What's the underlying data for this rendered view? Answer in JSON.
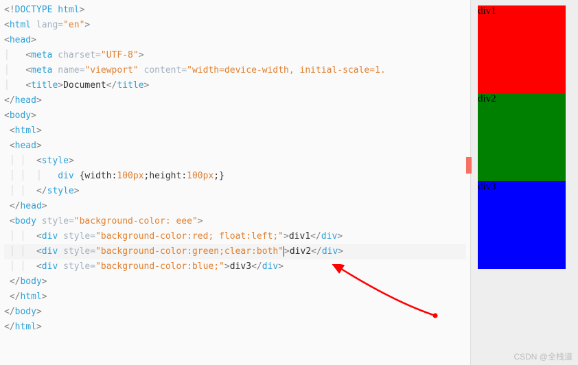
{
  "editor": {
    "lines": [
      {
        "indent": 0,
        "segments": [
          {
            "cls": "tag-bracket",
            "t": "<!"
          },
          {
            "cls": "doctype-kw",
            "t": "DOCTYPE"
          },
          {
            "cls": "plain",
            "t": " "
          },
          {
            "cls": "doctype-kw",
            "t": "html"
          },
          {
            "cls": "tag-bracket",
            "t": ">"
          }
        ]
      },
      {
        "indent": 0,
        "segments": [
          {
            "cls": "tag-bracket",
            "t": "<"
          },
          {
            "cls": "tag-name",
            "t": "html"
          },
          {
            "cls": "plain",
            "t": " "
          },
          {
            "cls": "attr-name",
            "t": "lang"
          },
          {
            "cls": "attr-eq",
            "t": "="
          },
          {
            "cls": "attr-val",
            "t": "\"en\""
          },
          {
            "cls": "tag-bracket",
            "t": ">"
          }
        ]
      },
      {
        "indent": 0,
        "segments": [
          {
            "cls": "tag-bracket",
            "t": "<"
          },
          {
            "cls": "tag-name",
            "t": "head"
          },
          {
            "cls": "tag-bracket",
            "t": ">"
          }
        ]
      },
      {
        "indent": 2,
        "guide": true,
        "segments": [
          {
            "cls": "tag-bracket",
            "t": "<"
          },
          {
            "cls": "tag-name",
            "t": "meta"
          },
          {
            "cls": "plain",
            "t": " "
          },
          {
            "cls": "attr-name",
            "t": "charset"
          },
          {
            "cls": "attr-eq",
            "t": "="
          },
          {
            "cls": "attr-val",
            "t": "\"UTF-8\""
          },
          {
            "cls": "tag-bracket",
            "t": ">"
          }
        ]
      },
      {
        "indent": 2,
        "guide": true,
        "segments": [
          {
            "cls": "tag-bracket",
            "t": "<"
          },
          {
            "cls": "tag-name",
            "t": "meta"
          },
          {
            "cls": "plain",
            "t": " "
          },
          {
            "cls": "attr-name",
            "t": "name"
          },
          {
            "cls": "attr-eq",
            "t": "="
          },
          {
            "cls": "attr-val",
            "t": "\"viewport\""
          },
          {
            "cls": "plain",
            "t": " "
          },
          {
            "cls": "attr-name",
            "t": "content"
          },
          {
            "cls": "attr-eq",
            "t": "="
          },
          {
            "cls": "attr-val",
            "t": "\"width=device-width, initial-scale=1."
          }
        ]
      },
      {
        "indent": 2,
        "guide": true,
        "segments": [
          {
            "cls": "tag-bracket",
            "t": "<"
          },
          {
            "cls": "tag-name",
            "t": "title"
          },
          {
            "cls": "tag-bracket",
            "t": ">"
          },
          {
            "cls": "plain",
            "t": "Document"
          },
          {
            "cls": "tag-bracket",
            "t": "</"
          },
          {
            "cls": "tag-name",
            "t": "title"
          },
          {
            "cls": "tag-bracket",
            "t": ">"
          }
        ]
      },
      {
        "indent": 0,
        "segments": [
          {
            "cls": "tag-bracket",
            "t": "</"
          },
          {
            "cls": "tag-name",
            "t": "head"
          },
          {
            "cls": "tag-bracket",
            "t": ">"
          }
        ]
      },
      {
        "indent": 0,
        "segments": [
          {
            "cls": "tag-bracket",
            "t": "<"
          },
          {
            "cls": "tag-name",
            "t": "body"
          },
          {
            "cls": "tag-bracket",
            "t": ">"
          }
        ]
      },
      {
        "indent": 1,
        "segments": [
          {
            "cls": "tag-bracket",
            "t": "<"
          },
          {
            "cls": "tag-name",
            "t": "html"
          },
          {
            "cls": "tag-bracket",
            "t": ">"
          }
        ]
      },
      {
        "indent": 1,
        "segments": [
          {
            "cls": "tag-bracket",
            "t": "<"
          },
          {
            "cls": "tag-name",
            "t": "head"
          },
          {
            "cls": "tag-bracket",
            "t": ">"
          }
        ]
      },
      {
        "indent": 3,
        "guide": true,
        "segments": [
          {
            "cls": "tag-bracket",
            "t": "<"
          },
          {
            "cls": "tag-name",
            "t": "style"
          },
          {
            "cls": "tag-bracket",
            "t": ">"
          }
        ]
      },
      {
        "indent": 4,
        "guide": true,
        "segments": [
          {
            "cls": "css-sel",
            "t": "div"
          },
          {
            "cls": "plain",
            "t": " {"
          },
          {
            "cls": "css-prop",
            "t": "width"
          },
          {
            "cls": "plain",
            "t": ":"
          },
          {
            "cls": "css-val",
            "t": "100px"
          },
          {
            "cls": "plain",
            "t": ";"
          },
          {
            "cls": "css-prop",
            "t": "height"
          },
          {
            "cls": "plain",
            "t": ":"
          },
          {
            "cls": "css-val",
            "t": "100px"
          },
          {
            "cls": "plain",
            "t": ";}"
          }
        ]
      },
      {
        "indent": 3,
        "guide": true,
        "segments": [
          {
            "cls": "tag-bracket",
            "t": "</"
          },
          {
            "cls": "tag-name",
            "t": "style"
          },
          {
            "cls": "tag-bracket",
            "t": ">"
          }
        ]
      },
      {
        "indent": 1,
        "segments": [
          {
            "cls": "tag-bracket",
            "t": "</"
          },
          {
            "cls": "tag-name",
            "t": "head"
          },
          {
            "cls": "tag-bracket",
            "t": ">"
          }
        ]
      },
      {
        "indent": 1,
        "segments": [
          {
            "cls": "tag-bracket",
            "t": "<"
          },
          {
            "cls": "tag-name",
            "t": "body"
          },
          {
            "cls": "plain",
            "t": " "
          },
          {
            "cls": "attr-name",
            "t": "style"
          },
          {
            "cls": "attr-eq",
            "t": "="
          },
          {
            "cls": "attr-val",
            "t": "\"background-color: eee\""
          },
          {
            "cls": "tag-bracket",
            "t": ">"
          }
        ]
      },
      {
        "indent": 3,
        "guide": true,
        "segments": [
          {
            "cls": "tag-bracket",
            "t": "<"
          },
          {
            "cls": "tag-name",
            "t": "div"
          },
          {
            "cls": "plain",
            "t": " "
          },
          {
            "cls": "attr-name",
            "t": "style"
          },
          {
            "cls": "attr-eq",
            "t": "="
          },
          {
            "cls": "attr-val",
            "t": "\"background-color:red; float:left;\""
          },
          {
            "cls": "tag-bracket",
            "t": ">"
          },
          {
            "cls": "plain",
            "t": "div1"
          },
          {
            "cls": "tag-bracket",
            "t": "</"
          },
          {
            "cls": "tag-name",
            "t": "div"
          },
          {
            "cls": "tag-bracket",
            "t": ">"
          }
        ]
      },
      {
        "indent": 3,
        "guide": true,
        "hl": true,
        "segments": [
          {
            "cls": "tag-bracket",
            "t": "<"
          },
          {
            "cls": "tag-name",
            "t": "div"
          },
          {
            "cls": "plain",
            "t": " "
          },
          {
            "cls": "attr-name",
            "t": "style"
          },
          {
            "cls": "attr-eq",
            "t": "="
          },
          {
            "cls": "attr-val",
            "t": "\"background-color:green;clear:both"
          },
          {
            "cls": "attr-val cursor-mark",
            "t": "\""
          },
          {
            "cls": "tag-bracket",
            "t": ">"
          },
          {
            "cls": "plain",
            "t": "div2"
          },
          {
            "cls": "tag-bracket",
            "t": "</"
          },
          {
            "cls": "tag-name",
            "t": "div"
          },
          {
            "cls": "tag-bracket",
            "t": ">"
          }
        ]
      },
      {
        "indent": 3,
        "guide": true,
        "segments": [
          {
            "cls": "tag-bracket",
            "t": "<"
          },
          {
            "cls": "tag-name",
            "t": "div"
          },
          {
            "cls": "plain",
            "t": " "
          },
          {
            "cls": "attr-name",
            "t": "style"
          },
          {
            "cls": "attr-eq",
            "t": "="
          },
          {
            "cls": "attr-val",
            "t": "\"background-color:blue;\""
          },
          {
            "cls": "tag-bracket",
            "t": ">"
          },
          {
            "cls": "plain",
            "t": "div3"
          },
          {
            "cls": "tag-bracket",
            "t": "</"
          },
          {
            "cls": "tag-name",
            "t": "div"
          },
          {
            "cls": "tag-bracket",
            "t": ">"
          }
        ]
      },
      {
        "indent": 1,
        "segments": [
          {
            "cls": "tag-bracket",
            "t": "</"
          },
          {
            "cls": "tag-name",
            "t": "body"
          },
          {
            "cls": "tag-bracket",
            "t": ">"
          }
        ]
      },
      {
        "indent": 1,
        "segments": [
          {
            "cls": "tag-bracket",
            "t": "</"
          },
          {
            "cls": "tag-name",
            "t": "html"
          },
          {
            "cls": "tag-bracket",
            "t": ">"
          }
        ]
      },
      {
        "indent": 0,
        "segments": [
          {
            "cls": "tag-bracket",
            "t": "</"
          },
          {
            "cls": "tag-name",
            "t": "body"
          },
          {
            "cls": "tag-bracket",
            "t": ">"
          }
        ]
      },
      {
        "indent": 0,
        "segments": [
          {
            "cls": "tag-bracket",
            "t": "</"
          },
          {
            "cls": "tag-name",
            "t": "html"
          },
          {
            "cls": "tag-bracket",
            "t": ">"
          }
        ]
      }
    ]
  },
  "preview": {
    "box1": "div1",
    "box2": "div2",
    "box3": "div3"
  },
  "watermark": "CSDN @全栈道"
}
